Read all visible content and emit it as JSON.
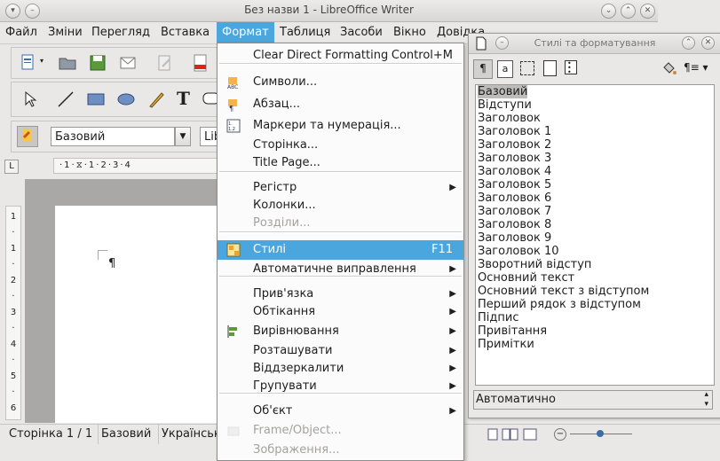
{
  "window": {
    "title": "Без назви 1 - LibreOffice Writer"
  },
  "menubar": {
    "items": [
      "Файл",
      "Зміни",
      "Перегляд",
      "Вставка",
      "Формат",
      "Таблиця",
      "Засоби",
      "Вікно",
      "Довідка"
    ]
  },
  "formatting": {
    "para_style": "Базовий",
    "font_name": "Lib"
  },
  "ruler": {
    "text": "·1·⧖·1·2·3·4"
  },
  "document": {
    "pilcrow": "¶"
  },
  "statusbar": {
    "page": "Сторінка 1 / 1",
    "style": "Базовий",
    "language": "Українськ"
  },
  "format_menu": {
    "items": [
      {
        "label": "Clear Direct Formatting",
        "accel": "Control+M"
      },
      {
        "label": "Символи...",
        "icon": "font-icon"
      },
      {
        "label": "Абзац...",
        "icon": "paragraph-icon"
      },
      {
        "label": "Маркери та нумерація...",
        "icon": "numbering-icon"
      },
      {
        "label": "Сторінка..."
      },
      {
        "label": "Title Page..."
      },
      {
        "label": "Регістр",
        "submenu": true
      },
      {
        "label": "Колонки..."
      },
      {
        "label": "Розділи...",
        "disabled": true
      },
      {
        "label": "Стилі",
        "accel": "F11",
        "highlighted": true,
        "icon": "styles-icon"
      },
      {
        "label": "Автоматичне виправлення",
        "submenu": true
      },
      {
        "label": "Прив'язка",
        "submenu": true
      },
      {
        "label": "Обтікання",
        "submenu": true
      },
      {
        "label": "Вирівнювання",
        "submenu": true,
        "icon": "align-icon"
      },
      {
        "label": "Розташувати",
        "submenu": true
      },
      {
        "label": "Віддзеркалити",
        "submenu": true
      },
      {
        "label": "Групувати",
        "submenu": true
      },
      {
        "label": "Об'єкт",
        "submenu": true
      },
      {
        "label": "Frame/Object...",
        "disabled": true,
        "icon": "frame-icon"
      },
      {
        "label": "Зображення...",
        "disabled": true
      }
    ]
  },
  "styles_panel": {
    "title": "Стилі та форматування",
    "styles": [
      "Базовий",
      "Відступи",
      "Заголовок",
      "Заголовок 1",
      "Заголовок 2",
      "Заголовок 3",
      "Заголовок 4",
      "Заголовок 5",
      "Заголовок 6",
      "Заголовок 7",
      "Заголовок 8",
      "Заголовок 9",
      "Заголовок 10",
      "Зворотний відступ",
      "Основний текст",
      "Основний текст з відступом",
      "Перший рядок з відступом",
      "Підпис",
      "Привітання",
      "Примітки"
    ],
    "selected": "Базовий",
    "filter": "Автоматично"
  },
  "colors": {
    "accent": "#4aa6dc"
  }
}
